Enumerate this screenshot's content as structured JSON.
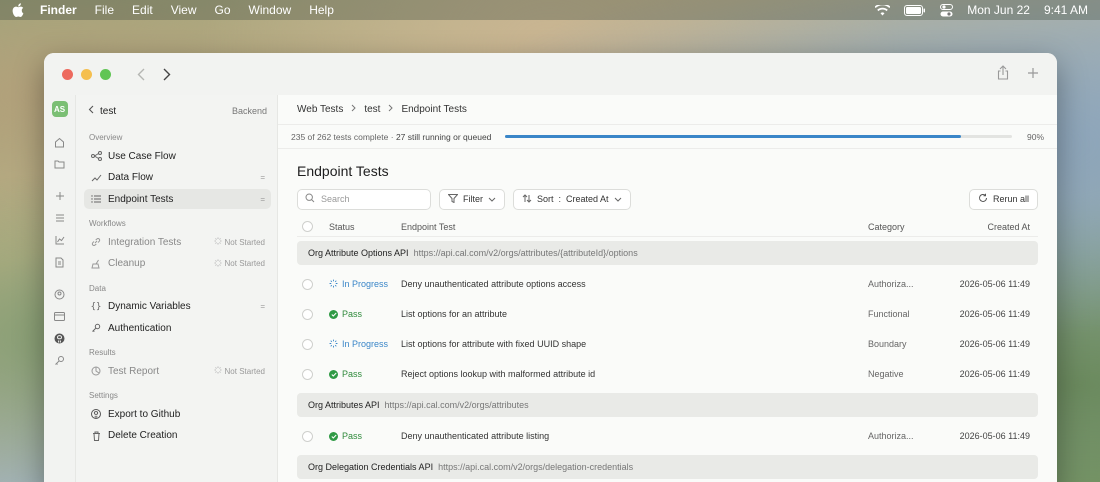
{
  "menubar": {
    "app": "Finder",
    "items": [
      "File",
      "Edit",
      "View",
      "Go",
      "Window",
      "Help"
    ],
    "date": "Mon Jun 22",
    "time": "9:41 AM"
  },
  "rail": {
    "avatar": "AS"
  },
  "sidebar": {
    "project": "test",
    "environment": "Backend",
    "sections": {
      "overview": "Overview",
      "workflows": "Workflows",
      "data": "Data",
      "results": "Results",
      "settings": "Settings"
    },
    "items": {
      "use_case_flow": "Use Case Flow",
      "data_flow": "Data Flow",
      "data_flow_trail": "=",
      "endpoint_tests": "Endpoint Tests",
      "endpoint_tests_trail": "=",
      "integration_tests": "Integration Tests",
      "integration_tests_trail": "Not Started",
      "cleanup": "Cleanup",
      "cleanup_trail": "Not Started",
      "dynamic_variables": "Dynamic Variables",
      "dynamic_variables_trail": "=",
      "authentication": "Authentication",
      "test_report": "Test Report",
      "test_report_trail": "Not Started",
      "export_github": "Export to Github",
      "delete_creation": "Delete Creation"
    }
  },
  "breadcrumb": [
    "Web Tests",
    "test",
    "Endpoint Tests"
  ],
  "progress": {
    "complete_text": "235 of 262 tests complete",
    "separator": "·",
    "running_text": "27 still running or queued",
    "percent_label": "90%",
    "fraction": 0.9
  },
  "page": {
    "title": "Endpoint Tests"
  },
  "toolbar": {
    "search_placeholder": "Search",
    "filter_label": "Filter",
    "sort_label": "Sort",
    "sort_sep": ":",
    "sort_value": "Created At",
    "rerun_label": "Rerun all"
  },
  "table": {
    "headers": {
      "status": "Status",
      "test": "Endpoint Test",
      "category": "Category",
      "created": "Created At"
    },
    "groups": [
      {
        "name": "Org Attribute Options API",
        "url": "https://api.cal.com/v2/orgs/attributes/{attributeId}/options",
        "rows": [
          {
            "status": "In Progress",
            "test": "Deny unauthenticated attribute options access",
            "category": "Authoriza...",
            "created": "2026-05-06 11:49"
          },
          {
            "status": "Pass",
            "test": "List options for an attribute",
            "category": "Functional",
            "created": "2026-05-06 11:49"
          },
          {
            "status": "In Progress",
            "test": "List options for attribute with fixed UUID shape",
            "category": "Boundary",
            "created": "2026-05-06 11:49"
          },
          {
            "status": "Pass",
            "test": "Reject options lookup with malformed attribute id",
            "category": "Negative",
            "created": "2026-05-06 11:49"
          }
        ]
      },
      {
        "name": "Org Attributes API",
        "url": "https://api.cal.com/v2/orgs/attributes",
        "rows": [
          {
            "status": "Pass",
            "test": "Deny unauthenticated attribute listing",
            "category": "Authoriza...",
            "created": "2026-05-06 11:49"
          }
        ]
      },
      {
        "name": "Org Delegation Credentials API",
        "url": "https://api.cal.com/v2/orgs/delegation-credentials",
        "rows": []
      }
    ]
  },
  "colors": {
    "accent": "#3a86c8",
    "pass": "#2f8a3c",
    "avatar": "#7bbf74"
  }
}
